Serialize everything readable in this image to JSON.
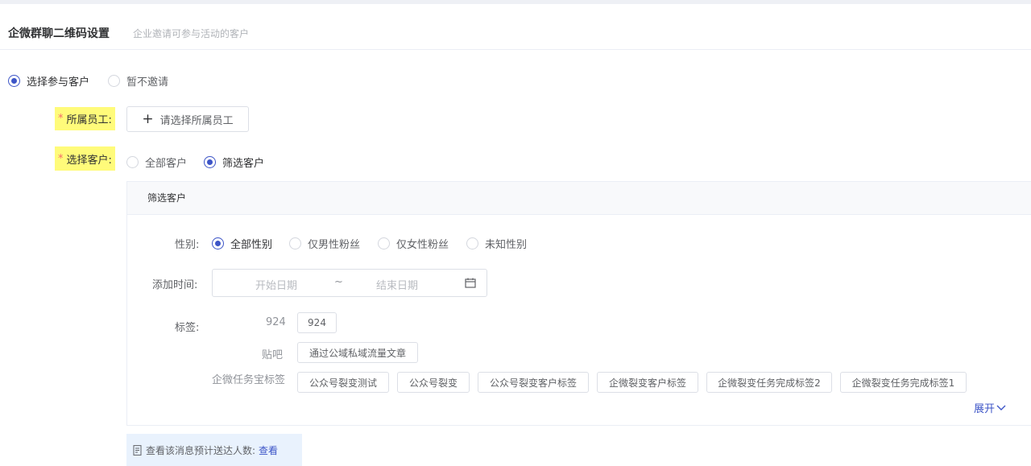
{
  "section": {
    "title": "企微群聊二维码设置",
    "subtitle": "企业邀请可参与活动的客户"
  },
  "invite_mode": {
    "options": [
      {
        "label": "选择参与客户",
        "checked": true
      },
      {
        "label": "暂不邀请",
        "checked": false
      }
    ]
  },
  "employee": {
    "required_mark": "*",
    "label": "所属员工:",
    "button_label": "请选择所属员工"
  },
  "customer": {
    "required_mark": "*",
    "label": "选择客户:",
    "options": [
      {
        "label": "全部客户",
        "checked": false
      },
      {
        "label": "筛选客户",
        "checked": true
      }
    ]
  },
  "filter": {
    "panel_title": "筛选客户",
    "gender": {
      "label": "性别:",
      "options": [
        {
          "label": "全部性别",
          "checked": true
        },
        {
          "label": "仅男性粉丝",
          "checked": false
        },
        {
          "label": "仅女性粉丝",
          "checked": false
        },
        {
          "label": "未知性别",
          "checked": false
        }
      ]
    },
    "add_time": {
      "label": "添加时间:",
      "start_placeholder": "开始日期",
      "separator": "~",
      "end_placeholder": "结束日期"
    },
    "tags": {
      "label": "标签:",
      "groups": [
        {
          "name": "924",
          "tags": [
            "924"
          ]
        },
        {
          "name": "贴吧",
          "tags": [
            "通过公域私域流量文章"
          ]
        },
        {
          "name": "企微任务宝标签",
          "tags": [
            "公众号裂变测试",
            "公众号裂变",
            "公众号裂变客户标签",
            "企微裂变客户标签",
            "企微裂变任务完成标签2",
            "企微裂变任务完成标签1"
          ]
        }
      ]
    },
    "expand_label": "展开"
  },
  "tip": {
    "text": "查看该消息预计送达人数:",
    "link": "查看"
  },
  "colors": {
    "accent": "#3d55c7",
    "highlight": "#fffb7a",
    "required": "#f56c6c",
    "tip_bg": "#e9f2fd"
  }
}
